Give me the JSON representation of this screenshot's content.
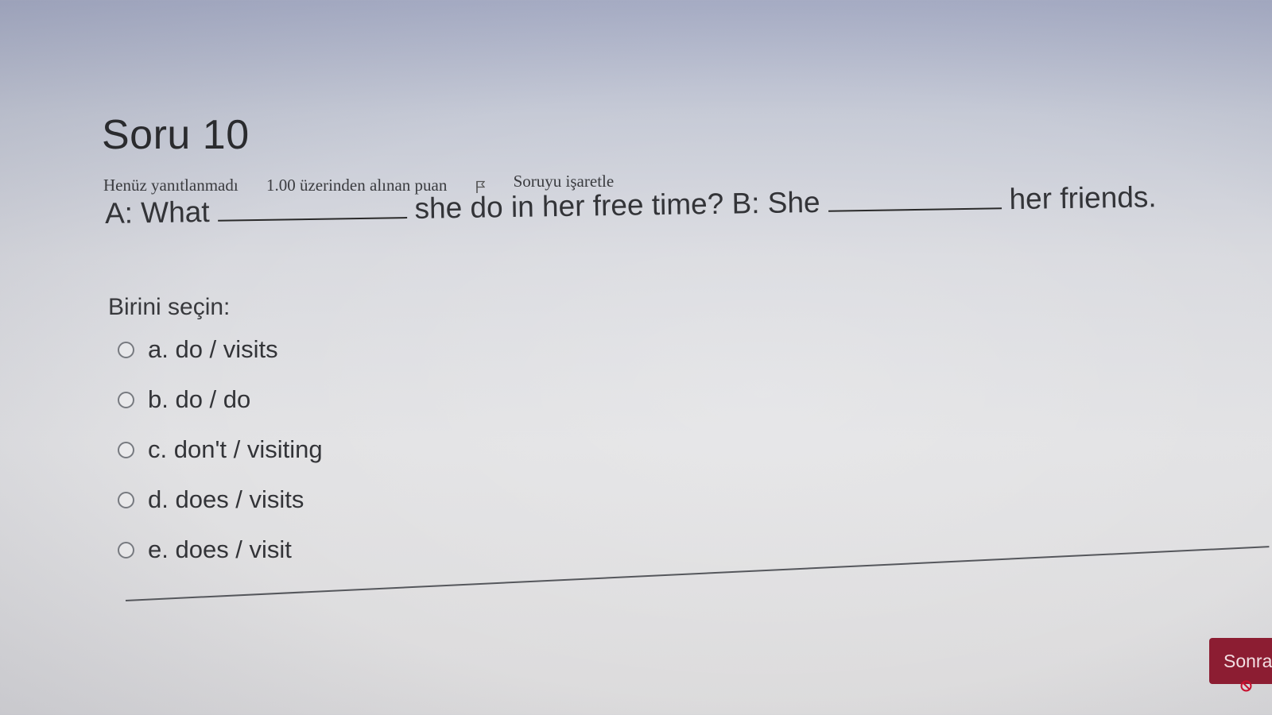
{
  "question": {
    "title": "Soru 10",
    "state": "Henüz yanıtlanmadı",
    "grade": "1.00 üzerinden alınan puan",
    "flag_label": "Soruyu işaretle",
    "text_part1": "A: What",
    "text_part2": "she do in her free time? B: She",
    "text_part3": "her friends.",
    "prompt": "Birini seçin:",
    "options": [
      {
        "label": "a. do / visits",
        "selected": false
      },
      {
        "label": "b. do / do",
        "selected": false
      },
      {
        "label": "c. don't / visiting",
        "selected": false
      },
      {
        "label": "d. does / visits",
        "selected": false
      },
      {
        "label": "e. does / visit",
        "selected": false
      }
    ]
  },
  "navigation": {
    "next_label": "Sonra"
  },
  "icons": {
    "flag": "flag-icon",
    "blocked": "blocked-icon"
  },
  "colors": {
    "next_button": "#8c1d32",
    "blocked_icon": "#c8102e"
  }
}
